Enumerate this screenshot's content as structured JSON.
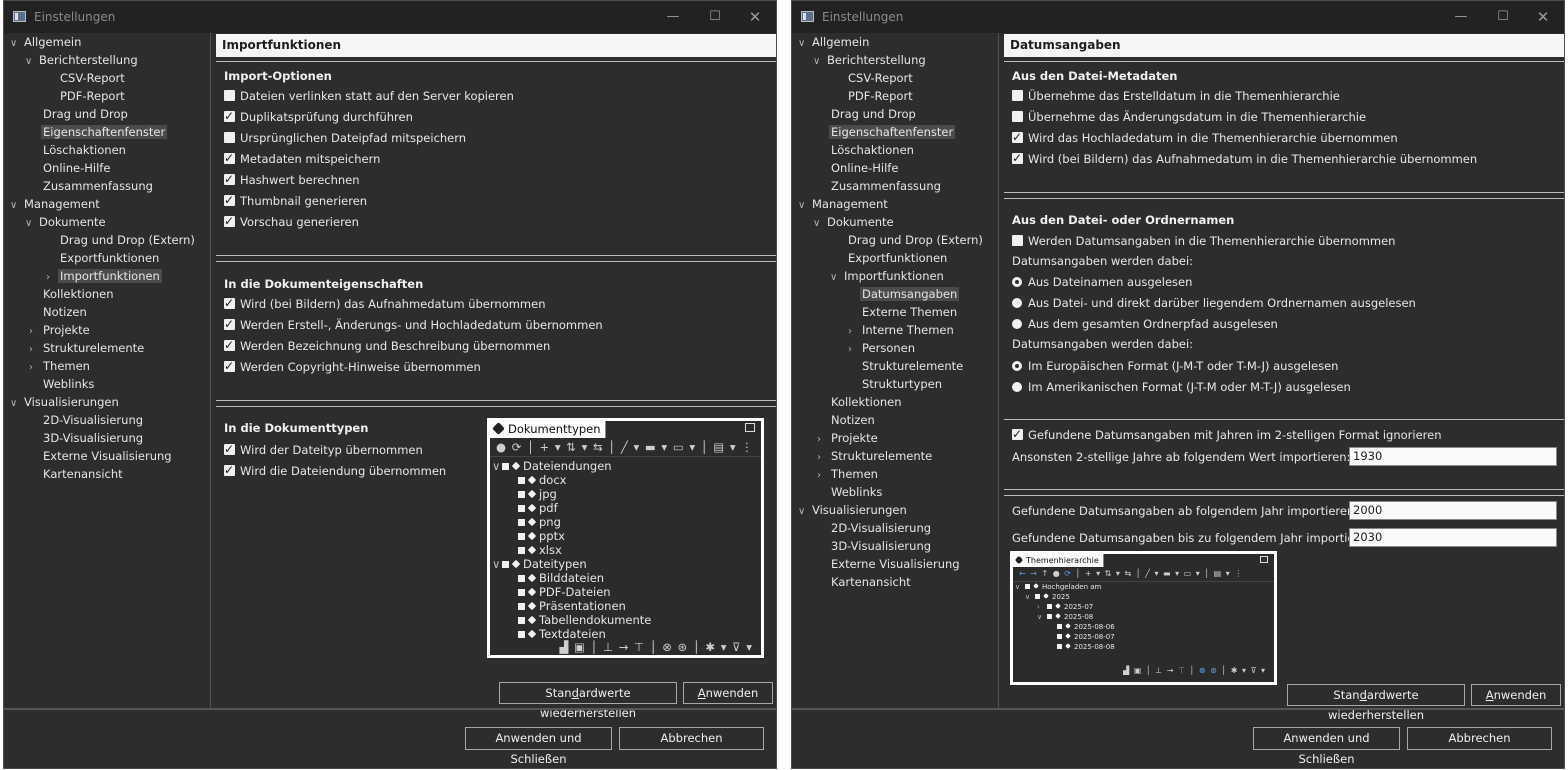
{
  "window_title": "Einstellungen",
  "window_controls": {
    "minimize": "—",
    "maximize": "☐",
    "close": "✕"
  },
  "left_window": {
    "tree": [
      "Allgemein",
      "Berichterstellung",
      "CSV-Report",
      "PDF-Report",
      "Drag und Drop",
      "Eigenschaftenfenster",
      "Löschaktionen",
      "Online-Hilfe",
      "Zusammenfassung",
      "Management",
      "Dokumente",
      "Drag und Drop (Extern)",
      "Exportfunktionen",
      "Importfunktionen",
      "Kollektionen",
      "Notizen",
      "Projekte",
      "Strukturelemente",
      "Themen",
      "Weblinks",
      "Visualisierungen",
      "2D-Visualisierung",
      "3D-Visualisierung",
      "Externe Visualisierung",
      "Kartenansicht"
    ],
    "page_title": "Importfunktionen",
    "section1_title": "Import-Optionen",
    "section1_options": [
      {
        "label": "Dateien verlinken statt auf den Server kopieren",
        "checked": false
      },
      {
        "label": "Duplikatsprüfung durchführen",
        "checked": true
      },
      {
        "label": "Ursprünglichen Dateipfad mitspeichern",
        "checked": false
      },
      {
        "label": "Metadaten mitspeichern",
        "checked": true
      },
      {
        "label": "Hashwert berechnen",
        "checked": true
      },
      {
        "label": "Thumbnail generieren",
        "checked": true
      },
      {
        "label": "Vorschau generieren",
        "checked": true
      }
    ],
    "section2_title": "In die Dokumenteigenschaften",
    "section2_options": [
      {
        "label": "Wird (bei Bildern) das Aufnahmedatum übernommen",
        "checked": true
      },
      {
        "label": "Werden Erstell-, Änderungs- und Hochladedatum übernommen",
        "checked": true
      },
      {
        "label": "Werden Bezeichnung und Beschreibung übernommen",
        "checked": true
      },
      {
        "label": "Werden Copyright-Hinweise übernommen",
        "checked": true
      }
    ],
    "section3_title": "In die Dokumenttypen",
    "section3_options": [
      {
        "label": "Wird der Dateityp übernommen",
        "checked": true
      },
      {
        "label": "Wird die Dateiendung übernommen",
        "checked": true
      }
    ],
    "popup": {
      "tab": "Dokumenttypen",
      "rows": [
        "Dateiendungen",
        "docx",
        "jpg",
        "pdf",
        "png",
        "pptx",
        "xlsx",
        "Dateitypen",
        "Bilddateien",
        "PDF-Dateien",
        "Präsentationen",
        "Tabellendokumente",
        "Textdateien"
      ]
    },
    "restore_prefix": "Stan",
    "restore_key": "d",
    "restore_suffix": "ardwerte wiederherstellen",
    "apply_key": "A",
    "apply_suffix": "nwenden"
  },
  "right_window": {
    "tree": [
      "Allgemein",
      "Berichterstellung",
      "CSV-Report",
      "PDF-Report",
      "Drag und Drop",
      "Eigenschaftenfenster",
      "Löschaktionen",
      "Online-Hilfe",
      "Zusammenfassung",
      "Management",
      "Dokumente",
      "Drag und Drop (Extern)",
      "Exportfunktionen",
      "Importfunktionen",
      "Datumsangaben",
      "Externe Themen",
      "Interne Themen",
      "Personen",
      "Strukturelemente",
      "Strukturtypen",
      "Kollektionen",
      "Notizen",
      "Projekte",
      "Strukturelemente",
      "Themen",
      "Weblinks",
      "Visualisierungen",
      "2D-Visualisierung",
      "3D-Visualisierung",
      "Externe Visualisierung",
      "Kartenansicht"
    ],
    "page_title": "Datumsangaben",
    "section1_title": "Aus den Datei-Metadaten",
    "section1_options": [
      {
        "label": "Übernehme das Erstelldatum in die Themenhierarchie",
        "checked": false
      },
      {
        "label": "Übernehme das Änderungsdatum in die Themenhierarchie",
        "checked": false
      },
      {
        "label": "Wird das Hochladedatum in die Themenhierarchie übernommen",
        "checked": true
      },
      {
        "label": "Wird (bei Bildern) das Aufnahmedatum in die Themenhierarchie übernommen",
        "checked": true
      }
    ],
    "section2_title": "Aus den Datei- oder Ordnernamen",
    "section2_checkbox": {
      "label": "Werden Datumsangaben in die Themenhierarchie übernommen",
      "checked": false
    },
    "radio_group1_label": "Datumsangaben werden dabei:",
    "radio_group1": [
      {
        "label": "Aus Dateinamen ausgelesen",
        "selected": true
      },
      {
        "label": "Aus Datei- und direkt darüber liegendem Ordnernamen ausgelesen",
        "selected": false
      },
      {
        "label": "Aus dem gesamten Ordnerpfad ausgelesen",
        "selected": false
      }
    ],
    "radio_group2_label": "Datumsangaben werden dabei:",
    "radio_group2": [
      {
        "label": "Im Europäischen Format (J-M-T oder T-M-J) ausgelesen",
        "selected": true
      },
      {
        "label": "Im Amerikanischen Format (J-T-M oder M-T-J) ausgelesen",
        "selected": false
      }
    ],
    "two_digit_checkbox": {
      "label": "Gefundene Datumsangaben mit Jahren im 2-stelligen Format ignorieren",
      "checked": true
    },
    "two_digit_label": "Ansonsten 2-stellige Jahre ab folgendem Wert importieren:",
    "two_digit_value": "1930",
    "from_year_label": "Gefundene Datumsangaben ab folgendem Jahr importieren:",
    "from_year_value": "2000",
    "to_year_label": "Gefundene Datumsangaben bis zu folgendem Jahr importieren:",
    "to_year_value": "2030",
    "popup": {
      "tab": "Themenhierarchie",
      "rows": [
        "Hochgeladen am",
        "2025",
        "2025-07",
        "2025-08",
        "2025-08-06",
        "2025-08-07",
        "2025-08-08"
      ]
    },
    "restore_prefix": "Stan",
    "restore_key": "d",
    "restore_suffix": "ardwerte wiederherstellen",
    "apply_key": "A",
    "apply_suffix": "nwenden"
  },
  "footer": {
    "apply_close": "Anwenden und Schließen",
    "cancel": "Abbrechen"
  },
  "colors": {
    "background": "#2d2d2d",
    "titlebar": "#222222",
    "header": "#f6f6f6",
    "selection": "#4b4b4b",
    "accent_blue": "#5aa0e6"
  }
}
